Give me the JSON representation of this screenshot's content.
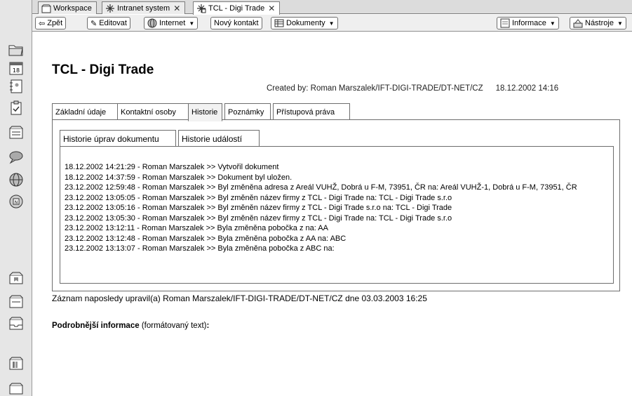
{
  "window_tabs": [
    {
      "label": "Workspace",
      "icon": "workspace-icon",
      "closable": false
    },
    {
      "label": "Intranet system",
      "icon": "database-icon",
      "closable": true
    },
    {
      "label": "TCL - Digi Trade",
      "icon": "document-icon",
      "closable": true
    }
  ],
  "toolbar": {
    "back_label": "Zpět",
    "edit_label": "Editovat",
    "internet_label": "Internet",
    "new_contact_label": "Nový kontakt",
    "documents_label": "Dokumenty",
    "info_label": "Informace",
    "tools_label": "Nástroje"
  },
  "document": {
    "title": "TCL - Digi Trade",
    "created_by": "Created by: Roman Marszalek/IFT-DIGI-TRADE/DT-NET/CZ",
    "created_date": "18.12.2002 14:16"
  },
  "doc_tabs": [
    "Základní údaje",
    "Kontaktní osoby",
    "Historie",
    "Poznámky",
    "Přístupová práva"
  ],
  "sub_tabs": [
    "Historie úprav dokumentu",
    "Historie událostí"
  ],
  "events": [
    {
      "time": "18.12.2002 14:21:29",
      "user": "Roman Marszalek",
      "text": "Vytvořil dokument"
    },
    {
      "time": "18.12.2002 14:37:59",
      "user": "Roman Marszalek",
      "text": "Dokument byl uložen."
    },
    {
      "time": "23.12.2002 12:59:48",
      "user": "Roman Marszalek",
      "text": "Byl změněna adresa z Areál VUHŽ, Dobrá u F-M, 73951, ČR  na:  Areál VUHŽ-1, Dobrá u F-M, 73951, ČR"
    },
    {
      "time": "23.12.2002 13:05:05",
      "user": "Roman Marszalek",
      "text": "Byl změněn název firmy z TCL - Digi Trade  na:  TCL - Digi Trade s.r.o"
    },
    {
      "time": "23.12.2002 13:05:16",
      "user": "Roman Marszalek",
      "text": "Byl změněn název firmy z TCL - Digi Trade s.r.o  na:  TCL - Digi Trade"
    },
    {
      "time": "23.12.2002 13:05:30",
      "user": "Roman Marszalek",
      "text": "Byl změněn název firmy z TCL - Digi Trade  na:  TCL - Digi Trade s.r.o"
    },
    {
      "time": "23.12.2002 13:12:11",
      "user": "Roman Marszalek",
      "text": "Byla změněna pobočka z  na:  AA"
    },
    {
      "time": "23.12.2002 13:12:48",
      "user": "Roman Marszalek",
      "text": "Byla změněna pobočka z AA  na:  ABC"
    },
    {
      "time": "23.12.2002 13:13:07",
      "user": "Roman Marszalek",
      "text": "Byla změněna pobočka z ABC  na:"
    }
  ],
  "event_dash": "-",
  "event_arrow": ">>",
  "last_modified": "Záznam naposledy upravil(a) Roman Marszalek/IFT-DIGI-TRADE/DT-NET/CZ dne 03.03.2003 16:25",
  "details_label": "Podrobnější informace",
  "details_hint": "(formátovaný text)",
  "details_colon": ":",
  "rail_icons": [
    "open-folder-icon",
    "calendar-icon",
    "address-book-icon",
    "todo-icon",
    "database-icon",
    "chat-icon",
    "globe-icon",
    "news-icon",
    "bookmark-icon",
    "folder-icon",
    "inbox-icon",
    "library-icon",
    "more-icon"
  ]
}
